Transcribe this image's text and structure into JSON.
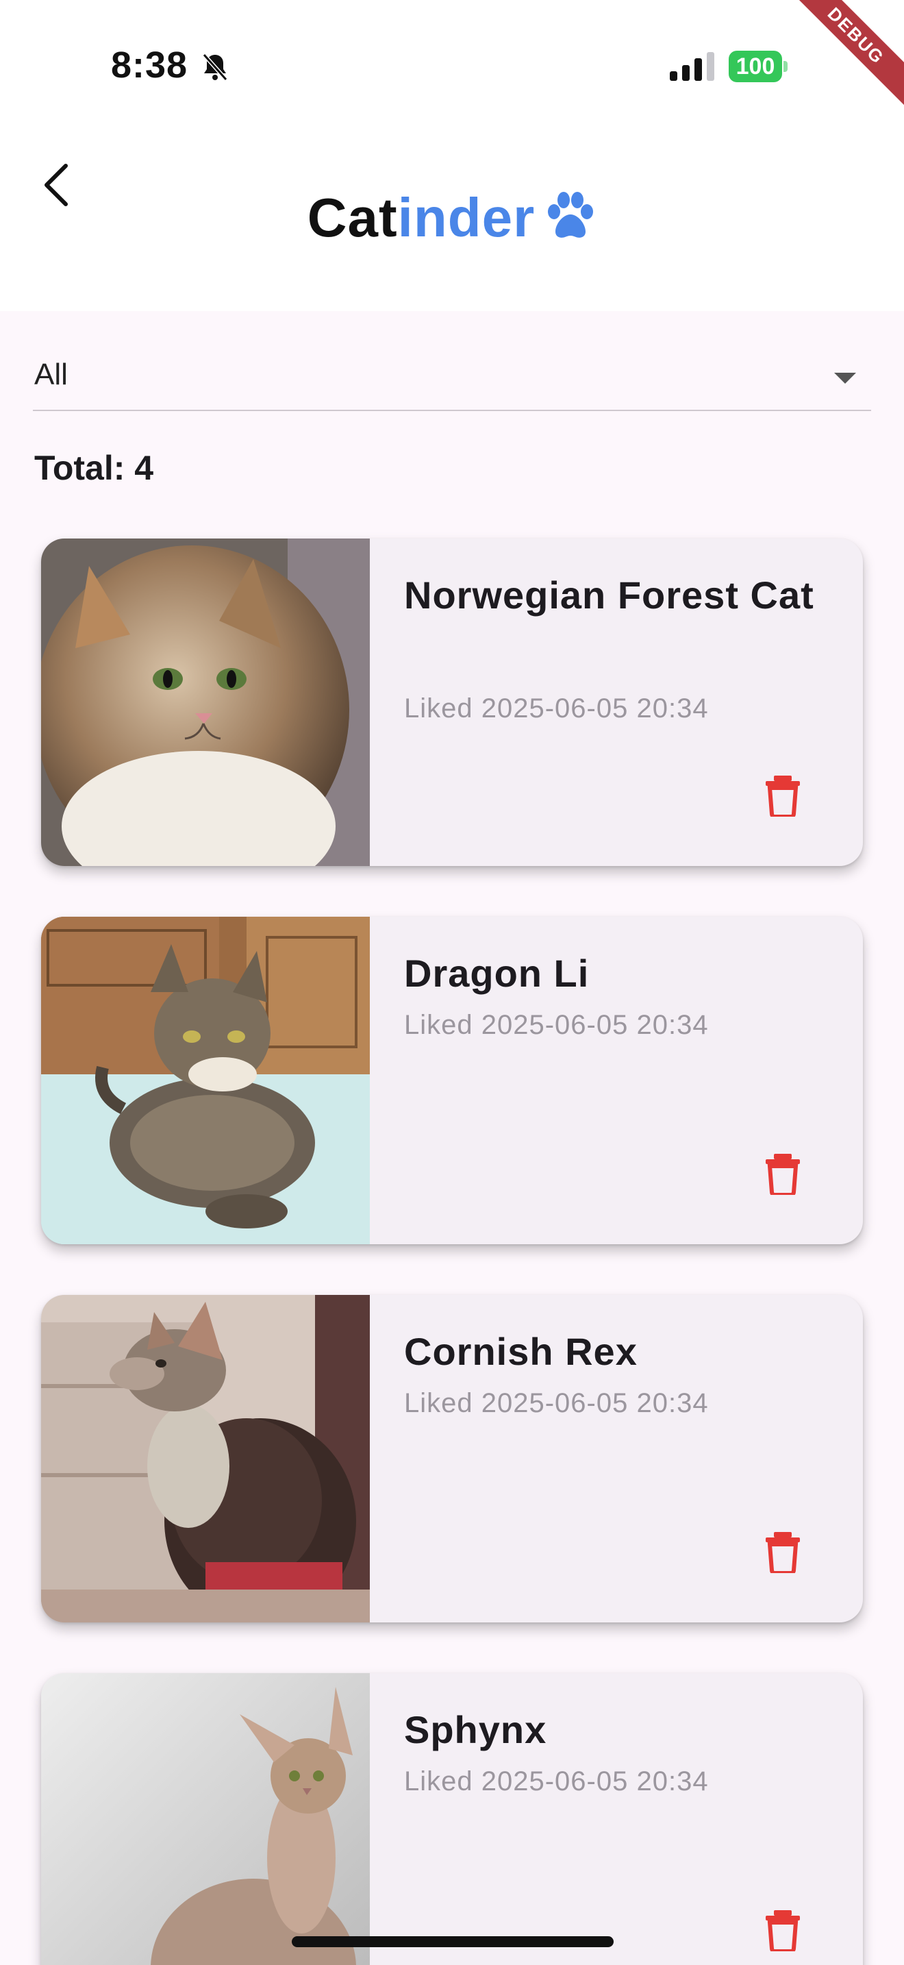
{
  "status_bar": {
    "time": "8:38",
    "battery": "100",
    "debug_label": "DEBUG"
  },
  "app_bar": {
    "title_part1": "Cat",
    "title_part2": "inder",
    "title_icon": "paw-icon",
    "back_icon": "chevron-left-icon"
  },
  "filter": {
    "selected": "All",
    "icon": "dropdown-caret-icon"
  },
  "total_label": "Total: 4",
  "cards": [
    {
      "name": "Norwegian Forest Cat",
      "liked": "Liked 2025-06-05 20:34",
      "photo": "norwegian-forest-cat-photo"
    },
    {
      "name": "Dragon Li",
      "liked": "Liked 2025-06-05 20:34",
      "photo": "dragon-li-photo"
    },
    {
      "name": "Cornish Rex",
      "liked": "Liked 2025-06-05 20:34",
      "photo": "cornish-rex-photo"
    },
    {
      "name": "Sphynx",
      "liked": "Liked 2025-06-05 20:34",
      "photo": "sphynx-photo"
    }
  ],
  "colors": {
    "accent_blue": "#4a86e8",
    "delete_red": "#e53935",
    "battery_green": "#34c759",
    "background": "#fdf7fc",
    "card_background": "#f4eff5"
  }
}
